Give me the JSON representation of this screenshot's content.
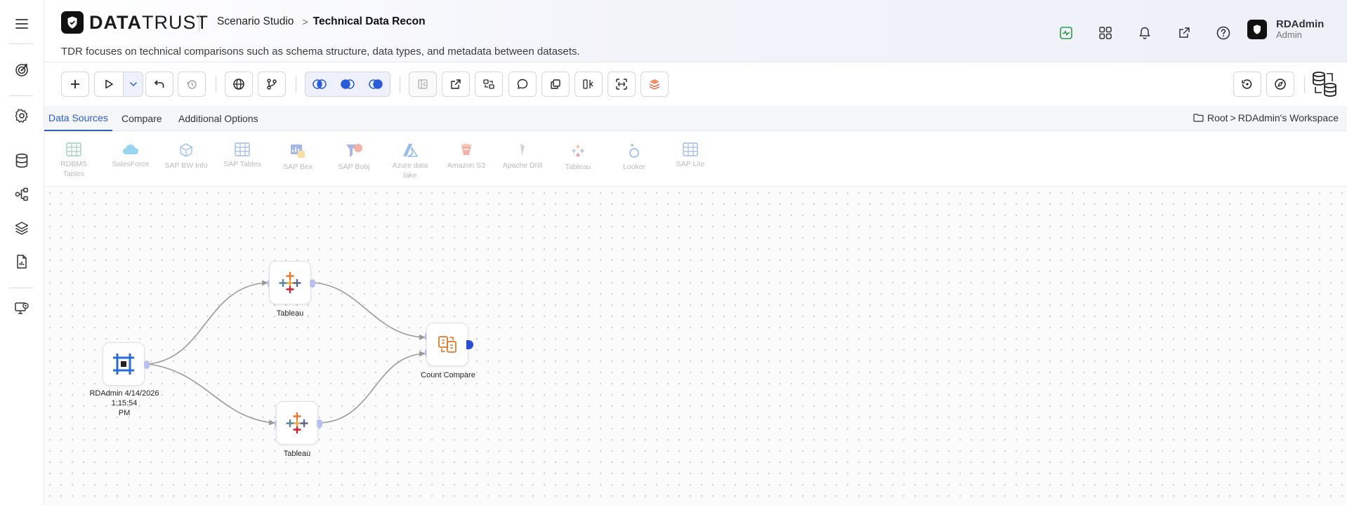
{
  "app": {
    "logo_bold": "DATA",
    "logo_light": "TRUST",
    "breadcrumb_studio": "Scenario Studio",
    "breadcrumb_sep": ">",
    "breadcrumb_page": "Technical Data Recon",
    "subtitle": "TDR focuses on technical comparisons such as schema structure, data types, and metadata between datasets."
  },
  "user": {
    "name": "RDAdmin",
    "role": "Admin"
  },
  "header_icons": [
    "activity-icon",
    "apps-grid-icon",
    "bell-icon",
    "external-link-icon",
    "help-icon"
  ],
  "rail_icons": [
    "menu-icon",
    "target-icon",
    "settings-icon",
    "database-icon",
    "lineage-icon",
    "layers-icon",
    "report-icon",
    "monitor-icon"
  ],
  "tabs": [
    {
      "label": "Data Sources",
      "active": true
    },
    {
      "label": "Compare",
      "active": false
    },
    {
      "label": "Additional Options",
      "active": false
    }
  ],
  "workspace": {
    "root": "Root",
    "sep": ">",
    "name": "RDAdmin's Workspace"
  },
  "palette": [
    {
      "line1": "RDBMS",
      "line2": "Tables"
    },
    {
      "line1": "SalesForce",
      "line2": ""
    },
    {
      "line1": "SAP BW Info",
      "line2": ""
    },
    {
      "line1": "SAP Tables",
      "line2": ""
    },
    {
      "line1": "SAP Bex",
      "line2": ""
    },
    {
      "line1": "SAP Bobj",
      "line2": ""
    },
    {
      "line1": "Azure data",
      "line2": "lake"
    },
    {
      "line1": "Amazon S3",
      "line2": ""
    },
    {
      "line1": "Apache Drill",
      "line2": ""
    },
    {
      "line1": "Tableau",
      "line2": ""
    },
    {
      "line1": "Looker",
      "line2": ""
    },
    {
      "line1": "SAP Lite",
      "line2": ""
    }
  ],
  "nodes": {
    "source": {
      "line1": "RDAdmin 4/14/2026 1:15:54",
      "line2": "PM"
    },
    "tableau_top": {
      "label": "Tableau"
    },
    "tableau_bottom": {
      "label": "Tableau"
    },
    "compare": {
      "label": "Count Compare"
    }
  },
  "colors": {
    "accent": "#2a5bd7",
    "port": "#b9c1f2",
    "edge": "#9a9a9a",
    "compare": "#e0782a",
    "status_green": "#2e9a47"
  }
}
